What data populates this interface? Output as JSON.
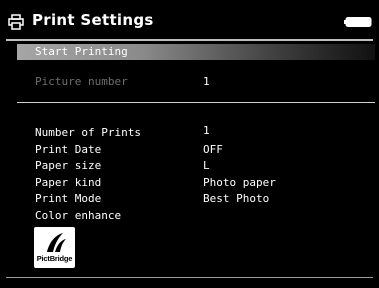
{
  "header": {
    "title": "Print Settings",
    "icon": "printer-icon",
    "status_icon": "battery-icon"
  },
  "menu": {
    "start_printing": "Start Printing",
    "picture_number": {
      "label": "Picture number",
      "value": "1"
    }
  },
  "settings": [
    {
      "label": "Number of Prints",
      "value": "1"
    },
    {
      "label": "Print Date",
      "value": "OFF"
    },
    {
      "label": "Paper size",
      "value": "L"
    },
    {
      "label": "Paper kind",
      "value": "Photo paper"
    },
    {
      "label": "Print Mode",
      "value": "Best Photo"
    },
    {
      "label": "Color enhance",
      "value": ""
    }
  ],
  "logo": {
    "text": "PictBridge"
  },
  "colors": {
    "background": "#000000",
    "text": "#ffffff",
    "disabled_text": "#6e6e6e",
    "highlight_start": "#a6a6a6",
    "highlight_end": "#111111"
  }
}
